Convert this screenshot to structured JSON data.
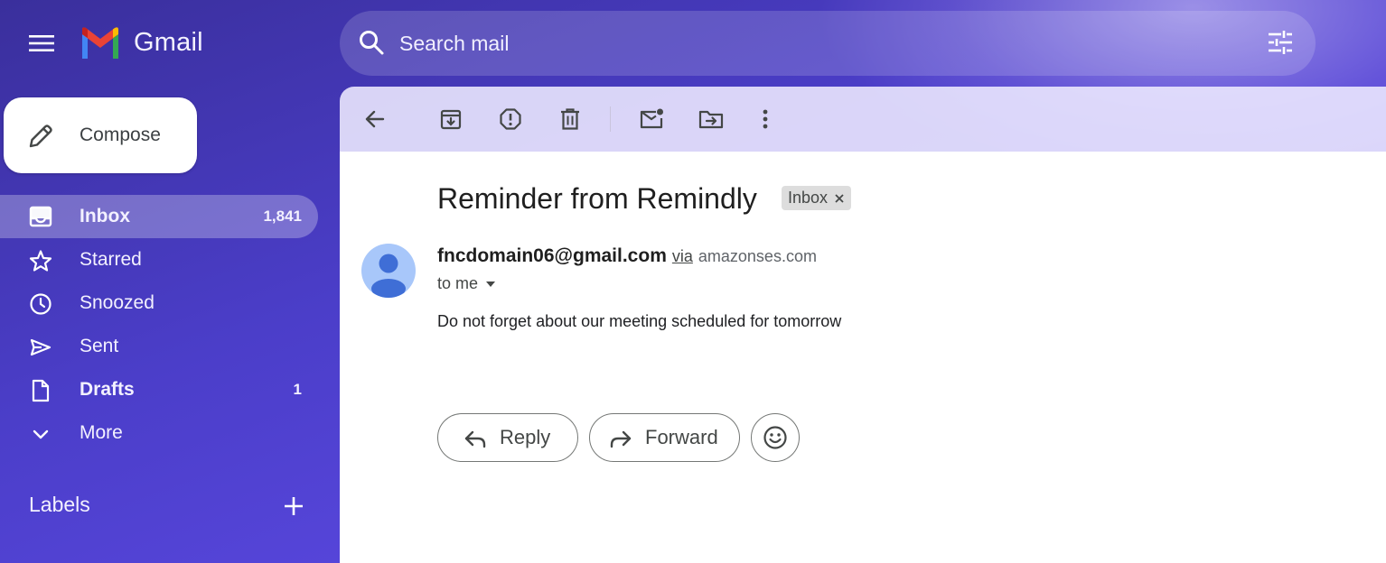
{
  "app": {
    "name": "Gmail",
    "brand_colors": {
      "red": "#EA4335",
      "blue": "#4285F4",
      "green": "#34A853",
      "yellow": "#FBBC04"
    }
  },
  "header": {
    "menu_icon": "hamburger-menu-icon",
    "search": {
      "placeholder": "Search mail",
      "value": ""
    },
    "filter_icon": "tune-icon"
  },
  "sidebar": {
    "compose_label": "Compose",
    "items": [
      {
        "label": "Inbox",
        "count": "1,841",
        "icon": "inbox-icon",
        "active": true,
        "bold": true
      },
      {
        "label": "Starred",
        "count": "",
        "icon": "star-icon",
        "active": false,
        "bold": false
      },
      {
        "label": "Snoozed",
        "count": "",
        "icon": "clock-icon",
        "active": false,
        "bold": false
      },
      {
        "label": "Sent",
        "count": "",
        "icon": "send-icon",
        "active": false,
        "bold": false
      },
      {
        "label": "Drafts",
        "count": "1",
        "icon": "draft-icon",
        "active": false,
        "bold": true
      },
      {
        "label": "More",
        "count": "",
        "icon": "chevron-down-icon",
        "active": false,
        "bold": false
      }
    ],
    "labels_heading": "Labels"
  },
  "toolbar": {
    "buttons": [
      "back-icon",
      "archive-icon",
      "report-spam-icon",
      "delete-icon",
      "mark-unread-icon",
      "move-to-icon",
      "more-vert-icon"
    ]
  },
  "message": {
    "subject": "Reminder from Remindly",
    "label_chip": "Inbox",
    "sender": "fncdomain06@gmail.com",
    "via": "via",
    "via_domain": "amazonses.com",
    "recipient": "to me",
    "body": "Do not forget about our meeting scheduled for tomorrow"
  },
  "actions": {
    "reply_label": "Reply",
    "forward_label": "Forward",
    "emoji_icon": "emoji-icon"
  }
}
